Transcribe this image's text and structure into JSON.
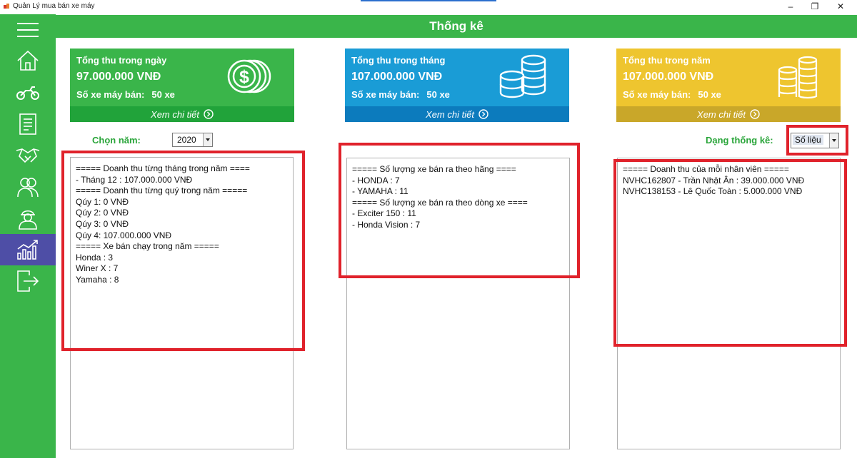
{
  "window": {
    "title": "Quản Lý mua bán xe máy",
    "controls": {
      "minimize": "–",
      "restore": "❐",
      "close": "✕"
    }
  },
  "header": {
    "title": "Thống kê"
  },
  "sidebar": {
    "items": [
      {
        "icon": "menu-icon"
      },
      {
        "icon": "home-icon"
      },
      {
        "icon": "motorbike-icon"
      },
      {
        "icon": "invoice-icon"
      },
      {
        "icon": "handshake-icon"
      },
      {
        "icon": "customers-icon"
      },
      {
        "icon": "employee-icon"
      },
      {
        "icon": "statistics-icon",
        "active": true
      },
      {
        "icon": "logout-icon"
      }
    ]
  },
  "cards": [
    {
      "title": "Tổng thu trong ngày",
      "amount": "97.000.000 VNĐ",
      "count_label": "Số xe máy bán:",
      "count_value": "50 xe",
      "footer": "Xem chi tiết",
      "color": "#3ab54a",
      "footer_color": "#21a33a",
      "icon": "dollar-coins-icon"
    },
    {
      "title": "Tổng thu trong tháng",
      "amount": "107.000.000 VNĐ",
      "count_label": "Số xe máy bán:",
      "count_value": "50 xe",
      "footer": "Xem chi tiết",
      "color": "#1a9cd6",
      "footer_color": "#0c7bbd",
      "icon": "coin-stacks-icon"
    },
    {
      "title": "Tổng thu trong năm",
      "amount": "107.000.000 VNĐ",
      "count_label": "Số xe máy bán:",
      "count_value": "50 xe",
      "footer": "Xem chi tiết",
      "color": "#eec52f",
      "footer_color": "#c9a729",
      "icon": "coin-stacks-icon"
    }
  ],
  "controls": {
    "year_label": "Chọn năm:",
    "year_value": "2020",
    "stat_type_label": "Dạng thống kê:",
    "stat_type_value": "Số liệu"
  },
  "panels": {
    "revenue": "===== Doanh thu từng tháng trong năm ====\n- Tháng 12 : 107.000.000 VNĐ\n===== Doanh thu từng quý trong năm =====\nQúy 1: 0 VNĐ\nQúy 2: 0 VNĐ\nQúy 3: 0 VNĐ\nQúy 4: 107.000.000 VNĐ\n===== Xe bán chạy trong năm =====\nHonda : 3\nWiner X : 7\nYamaha : 8",
    "brands": "===== Số lượng xe bán ra theo hãng ====\n- HONDA : 7\n- YAMAHA : 11\n===== Số lượng xe bán ra theo dòng xe ====\n- Exciter 150 : 11\n- Honda Vision : 7",
    "employees": "===== Doanh thu của mỗi nhân viên =====\nNVHC162807 - Trần Nhật Ân : 39.000.000 VNĐ\nNVHC138153 - Lê Quốc Toàn : 5.000.000 VNĐ"
  },
  "colors": {
    "sidebar": "#3ab54a",
    "active_item": "#4e4ea6",
    "highlight": "#e0222b",
    "label_green": "#2aa53a"
  }
}
